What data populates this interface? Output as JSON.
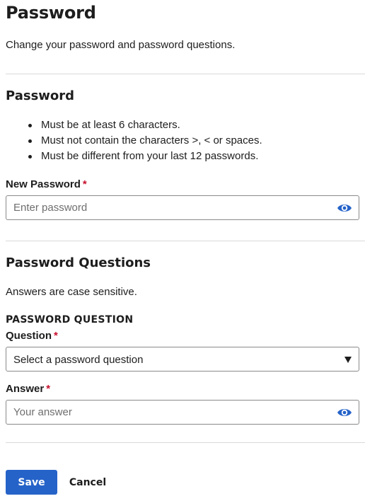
{
  "page": {
    "title": "Password",
    "subtitle": "Change your password and password questions."
  },
  "password_section": {
    "heading": "Password",
    "rules": [
      "Must be at least 6 characters.",
      "Must not contain the characters >, < or spaces.",
      "Must be different from your last 12 passwords."
    ],
    "new_password": {
      "label": "New Password",
      "required_marker": "*",
      "value": "",
      "placeholder": "Enter password",
      "toggle_icon": "eye-icon"
    }
  },
  "questions_section": {
    "heading": "Password Questions",
    "note": "Answers are case sensitive.",
    "group_label": "PASSWORD QUESTION",
    "question": {
      "label": "Question",
      "required_marker": "*",
      "selected": "Select a password question",
      "dropdown_icon": "caret-down-icon"
    },
    "answer": {
      "label": "Answer",
      "required_marker": "*",
      "value": "",
      "placeholder": "Your answer",
      "toggle_icon": "eye-icon"
    }
  },
  "actions": {
    "save_label": "Save",
    "cancel_label": "Cancel"
  },
  "colors": {
    "primary_button": "#2563c9",
    "required_marker": "#c8102e",
    "eye_icon": "#2563c9",
    "divider": "#d9d9d9",
    "input_border": "#8a8a8a"
  }
}
